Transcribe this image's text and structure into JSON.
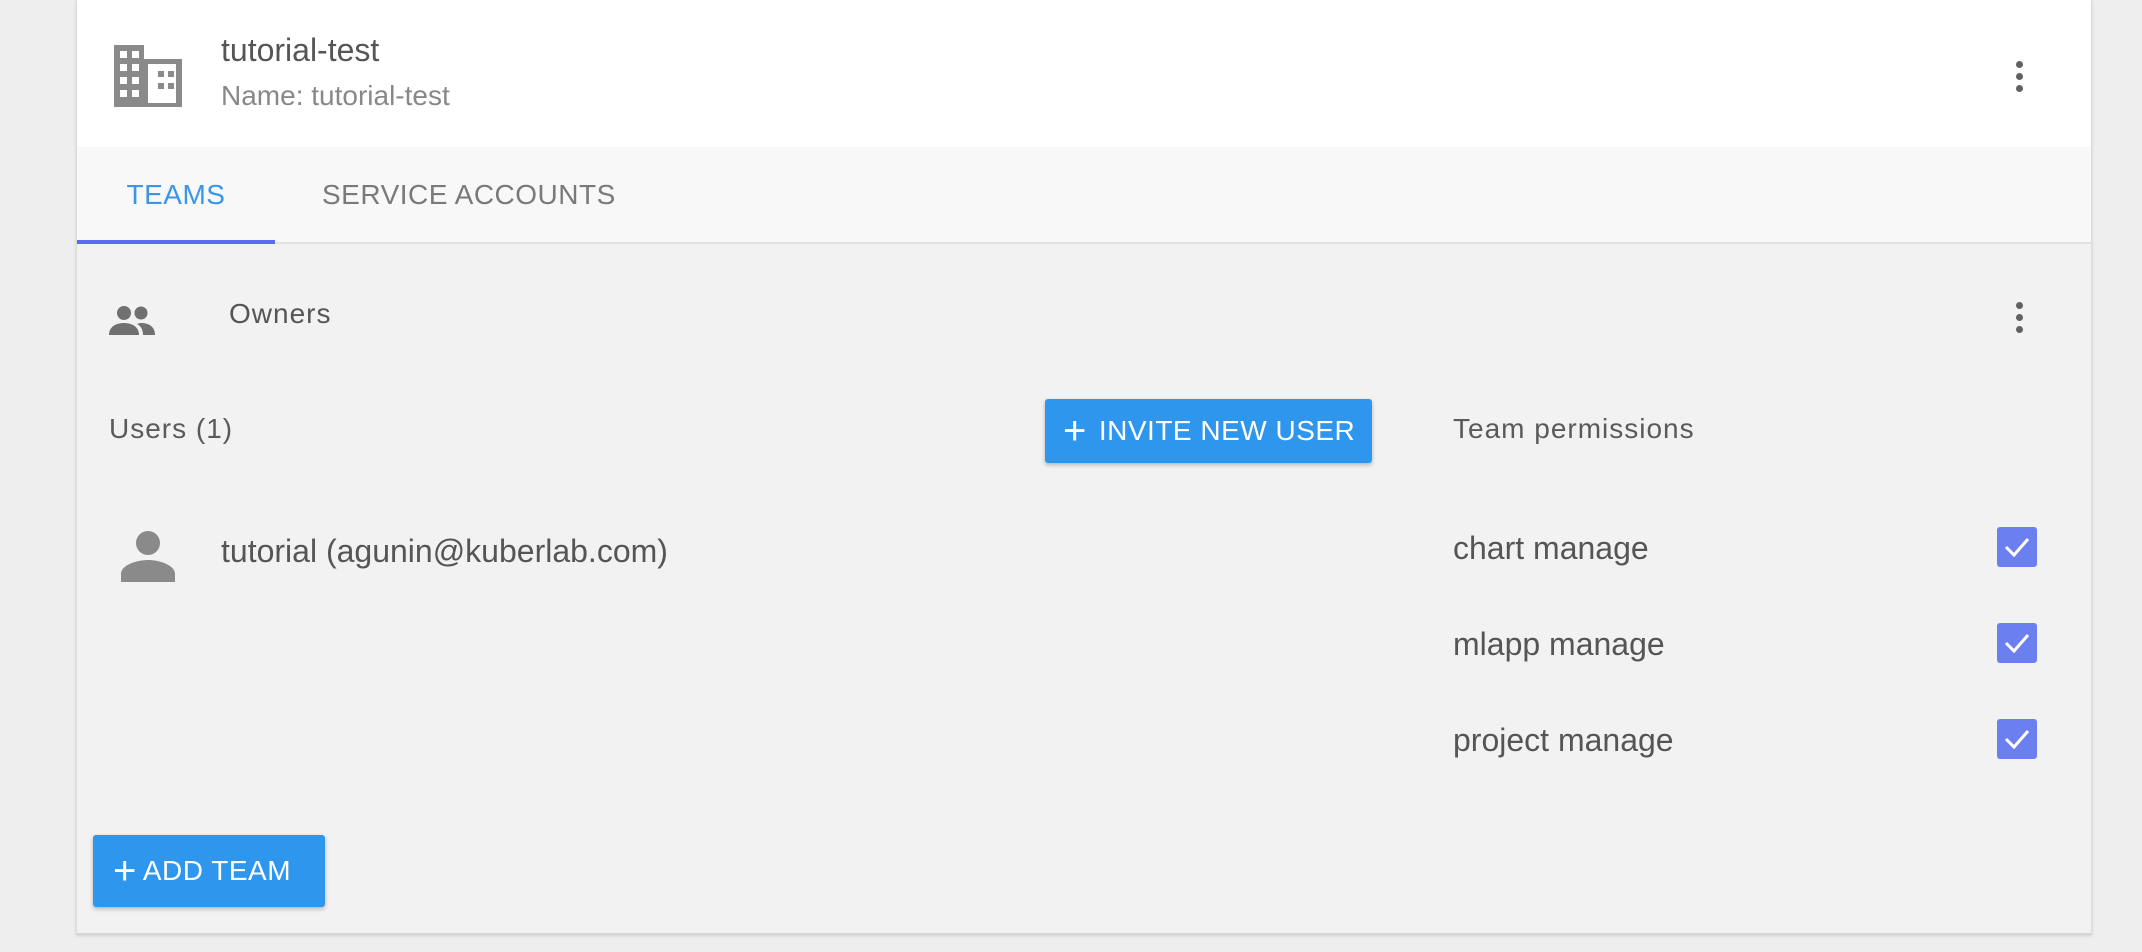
{
  "organization": {
    "title": "tutorial-test",
    "subtitle": "Name: tutorial-test",
    "icon": "building-icon",
    "menu_icon": "more-vert-icon"
  },
  "tabs": [
    {
      "label": "TEAMS",
      "active": true
    },
    {
      "label": "SERVICE ACCOUNTS",
      "active": false
    }
  ],
  "team": {
    "name": "Owners",
    "icon": "group-icon",
    "menu_icon": "more-vert-icon",
    "users_label": "Users (1)",
    "invite_button": "INVITE NEW USER",
    "permissions_label": "Team permissions",
    "users": [
      {
        "display": "tutorial (agunin@kuberlab.com)",
        "icon": "person-icon"
      }
    ],
    "permissions": [
      {
        "label": "chart manage",
        "checked": true
      },
      {
        "label": "mlapp manage",
        "checked": true
      },
      {
        "label": "project manage",
        "checked": true
      }
    ]
  },
  "add_team_button": "ADD TEAM",
  "colors": {
    "accent": "#2f96ee",
    "active_tab": "#3b95e8",
    "tab_indicator": "#5a6cf0",
    "checkbox": "#6b7ff0"
  }
}
